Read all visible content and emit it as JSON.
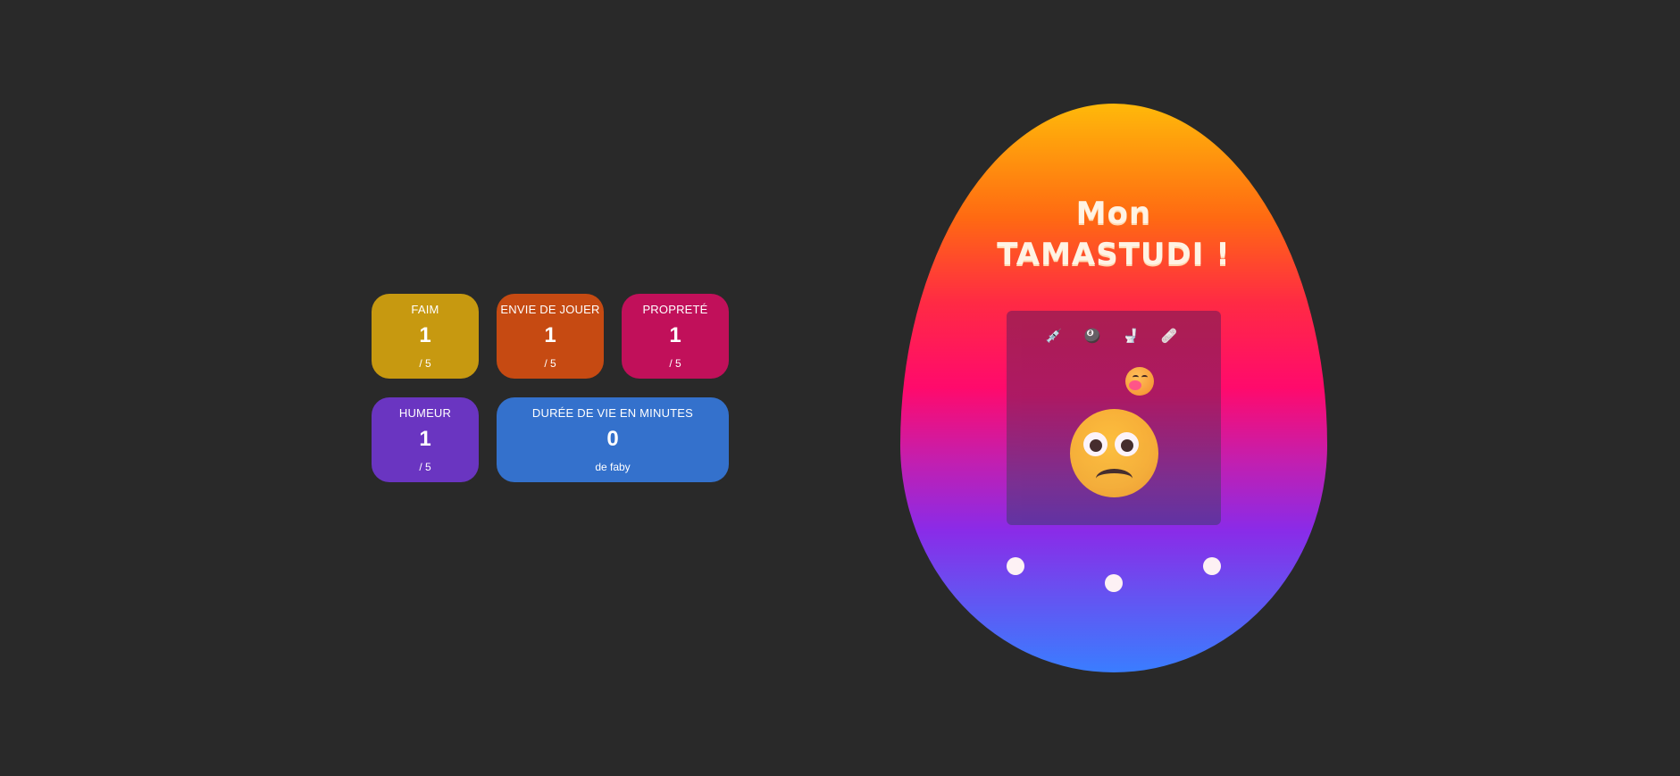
{
  "stats": {
    "hunger": {
      "title": "FAIM",
      "value": "1",
      "max": "/ 5",
      "color": "#c79910"
    },
    "play": {
      "title": "ENVIE DE JOUER",
      "value": "1",
      "max": "/ 5",
      "color": "#c64a12"
    },
    "cleanliness": {
      "title": "PROPRETÉ",
      "value": "1",
      "max": "/ 5",
      "color": "#c1105a"
    },
    "mood": {
      "title": "HUMEUR",
      "value": "1",
      "max": "/ 5",
      "color": "#6a35c1"
    },
    "lifespan": {
      "title": "DURÉE DE VIE EN MINUTES",
      "value": "0",
      "owner": "de faby",
      "color": "#3471cc"
    }
  },
  "tamagotchi": {
    "title_line1": "Mon",
    "title_line2": "TAMASTUDI !",
    "actions": [
      {
        "icon": "syringe-icon",
        "glyph": "💉"
      },
      {
        "icon": "balls-icon",
        "glyph": "🎱"
      },
      {
        "icon": "toilet-icon",
        "glyph": "🚽"
      },
      {
        "icon": "bandage-icon",
        "glyph": "🩹"
      }
    ],
    "emotion_bubble": "yawning-face-icon",
    "pet_face": "sad-face-icon",
    "egg_gradient": [
      "#ffb90a",
      "#ff6a12",
      "#ff0a6c",
      "#8a2be8",
      "#3a7dff"
    ]
  }
}
